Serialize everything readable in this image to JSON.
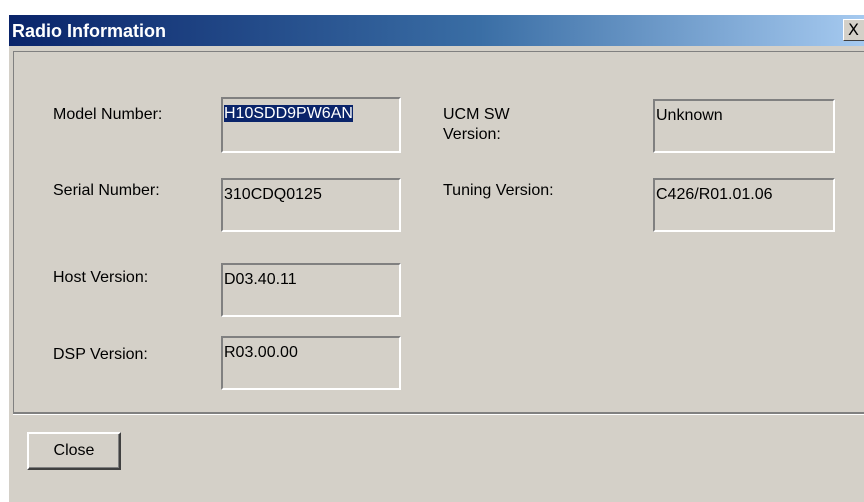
{
  "window": {
    "title": "Radio Information",
    "close_glyph": "X",
    "close_icon": "close-icon"
  },
  "fields": {
    "model_number": {
      "label": "Model Number:",
      "value": "H10SDD9PW6AN",
      "selected": true
    },
    "serial_number": {
      "label": "Serial Number:",
      "value": "310CDQ0125"
    },
    "host_version": {
      "label": "Host Version:",
      "value": "D03.40.11"
    },
    "dsp_version": {
      "label": "DSP Version:",
      "value": "R03.00.00"
    },
    "ucm_sw_version": {
      "label_line1": "UCM SW",
      "label_line2": "Version:",
      "value": "Unknown"
    },
    "tuning_version": {
      "label": "Tuning Version:",
      "value": "C426/R01.01.06"
    }
  },
  "buttons": {
    "close_label": "Close"
  },
  "colors": {
    "title_bar_start": "#0a246a",
    "title_bar_end": "#a6caf0",
    "face": "#d4d0c8",
    "selection": "#0a246a"
  }
}
